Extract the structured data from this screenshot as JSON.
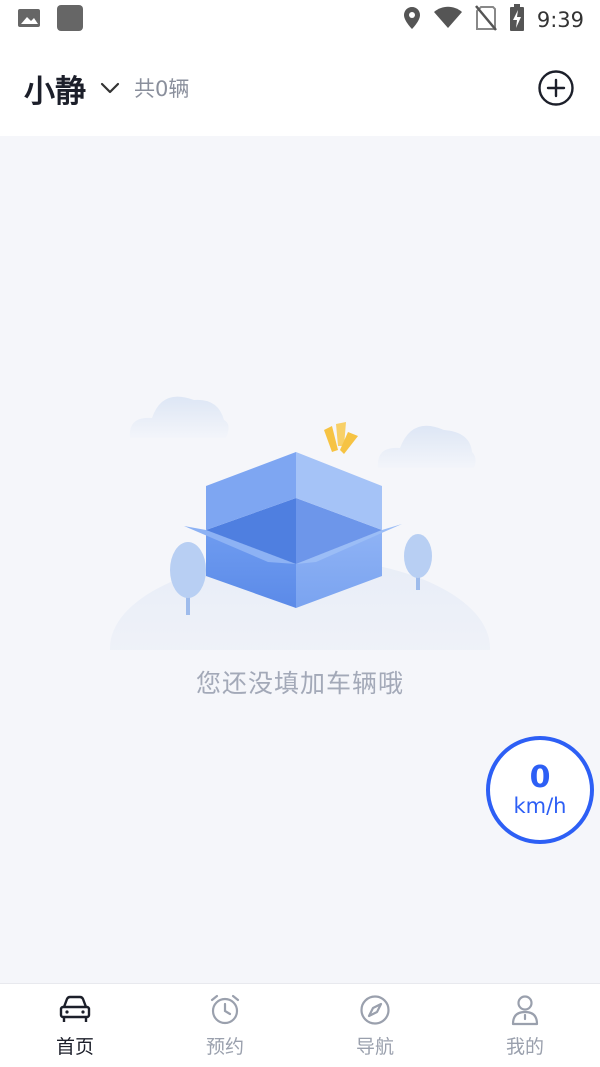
{
  "status_bar": {
    "time": "9:39",
    "left_icons": [
      "image-icon",
      "app-square-icon"
    ],
    "right_icons": [
      "location-icon",
      "wifi-icon",
      "no-sim-icon",
      "battery-charging-icon"
    ]
  },
  "header": {
    "user_name": "小静",
    "vehicle_count": "共0辆",
    "dropdown_icon": "chevron-down-icon",
    "add_icon": "add-circle-icon"
  },
  "empty_state": {
    "message": "您还没填加车辆哦",
    "illustration": "open-box-illustration"
  },
  "speed": {
    "value": "0",
    "unit": "km/h",
    "accent": "#2d5ff5"
  },
  "bottom_nav": {
    "items": [
      {
        "label": "首页",
        "icon": "car-icon",
        "active": true
      },
      {
        "label": "预约",
        "icon": "alarm-clock-icon",
        "active": false
      },
      {
        "label": "导航",
        "icon": "compass-icon",
        "active": false
      },
      {
        "label": "我的",
        "icon": "person-icon",
        "active": false
      }
    ]
  }
}
